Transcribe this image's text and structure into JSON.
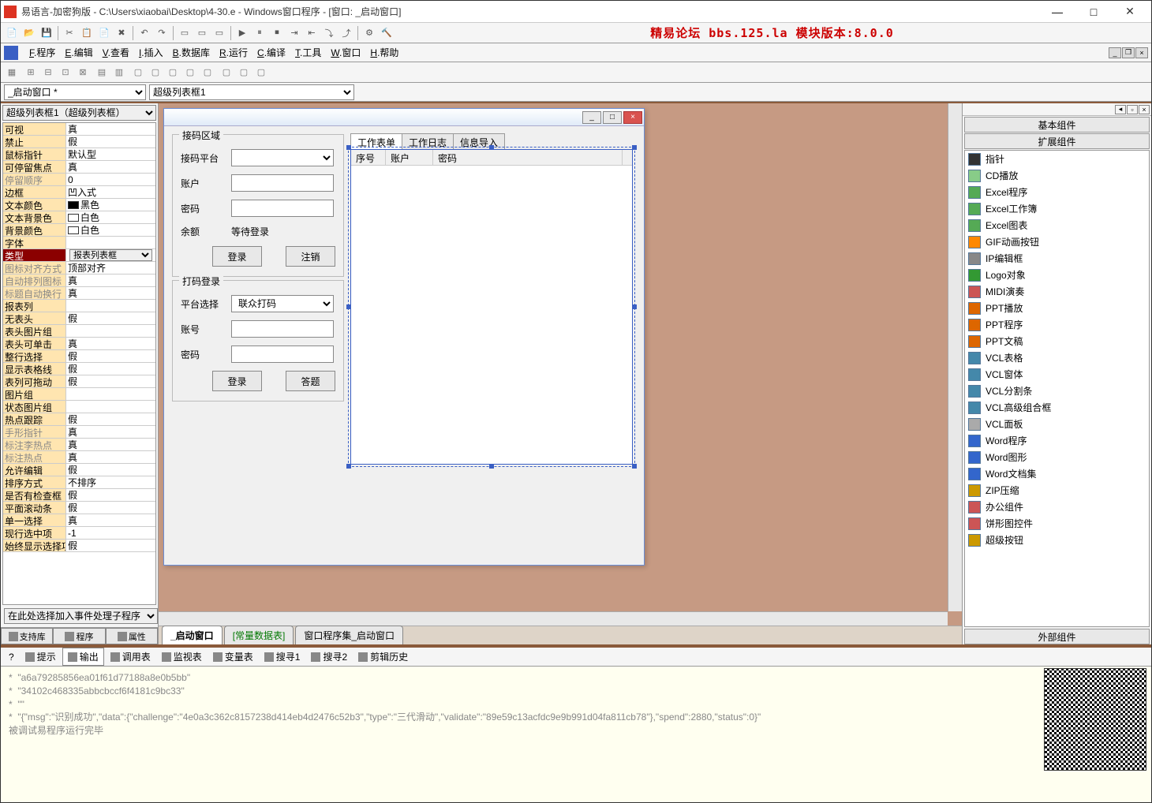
{
  "title": "易语言-加密狗版 - C:\\Users\\xiaobai\\Desktop\\4-30.e - Windows窗口程序 - [窗口: _启动窗口]",
  "banner": "精易论坛 bbs.125.la 模块版本:8.0.0",
  "menus": [
    "F.程序",
    "E.编辑",
    "V.查看",
    "I.插入",
    "B.数据库",
    "R.运行",
    "C.编译",
    "T.工具",
    "W.窗口",
    "H.帮助"
  ],
  "selectors": {
    "window": "_启动窗口 *",
    "control": "超级列表框1"
  },
  "leftCombo": "超级列表框1（超级列表框）",
  "propGrid": [
    {
      "n": "可视",
      "v": "真"
    },
    {
      "n": "禁止",
      "v": "假"
    },
    {
      "n": "鼠标指针",
      "v": "默认型"
    },
    {
      "n": "可停留焦点",
      "v": "真"
    },
    {
      "n": "停留顺序",
      "v": "0",
      "dim": true,
      "indent": true
    },
    {
      "n": "边框",
      "v": "凹入式"
    },
    {
      "n": "文本颜色",
      "v": "黑色",
      "swatch": "#000000"
    },
    {
      "n": "文本背景色",
      "v": "白色",
      "swatch": "#ffffff"
    },
    {
      "n": "背景颜色",
      "v": "白色",
      "swatch": "#ffffff"
    },
    {
      "n": "字体",
      "v": ""
    },
    {
      "n": "类型",
      "v": "报表列表框",
      "sel": true,
      "dd": true
    },
    {
      "n": "图标对齐方式",
      "v": "顶部对齐",
      "dim": true,
      "indent": true
    },
    {
      "n": "自动排列图标",
      "v": "真",
      "dim": true,
      "indent": true
    },
    {
      "n": "标题自动换行",
      "v": "真",
      "dim": true,
      "indent": true
    },
    {
      "n": "报表列",
      "v": "",
      "indent": true
    },
    {
      "n": "无表头",
      "v": "假",
      "indent": true
    },
    {
      "n": "表头图片组",
      "v": "",
      "indent": true
    },
    {
      "n": "表头可单击",
      "v": "真",
      "indent": true
    },
    {
      "n": "整行选择",
      "v": "假",
      "indent": true
    },
    {
      "n": "显示表格线",
      "v": "假",
      "indent": true
    },
    {
      "n": "表列可拖动",
      "v": "假",
      "indent": true
    },
    {
      "n": "图片组",
      "v": ""
    },
    {
      "n": "状态图片组",
      "v": ""
    },
    {
      "n": "热点跟踪",
      "v": "假"
    },
    {
      "n": "手形指针",
      "v": "真",
      "dim": true,
      "indent": true
    },
    {
      "n": "标注李热点",
      "v": "真",
      "dim": true,
      "indent": true
    },
    {
      "n": "标注热点",
      "v": "真",
      "dim": true,
      "indent": true
    },
    {
      "n": "允许编辑",
      "v": "假"
    },
    {
      "n": "排序方式",
      "v": "不排序"
    },
    {
      "n": "是否有检查框",
      "v": "假"
    },
    {
      "n": "平面滚动条",
      "v": "假"
    },
    {
      "n": "单一选择",
      "v": "真"
    },
    {
      "n": "现行选中项",
      "v": "-1"
    },
    {
      "n": "始终显示选择项",
      "v": "假"
    }
  ],
  "eventCombo": "在此处选择加入事件处理子程序",
  "leftTabs": [
    "支持库",
    "程序",
    "属性"
  ],
  "form": {
    "group1": {
      "title": "接码区域",
      "platform_label": "接码平台",
      "account_label": "账户",
      "password_label": "密码",
      "balance_label": "余额",
      "wait_label": "等待登录",
      "login_btn": "登录",
      "logout_btn": "注销"
    },
    "group2": {
      "title": "打码登录",
      "platform_label": "平台选择",
      "platform_value": "联众打码",
      "account_label": "账号",
      "password_label": "密码",
      "login_btn": "登录",
      "answer_btn": "答题"
    },
    "tabs": [
      "工作表单",
      "工作日志",
      "信息导入"
    ],
    "lv_cols": [
      "序号",
      "账户",
      "密码"
    ]
  },
  "centerTabs": [
    {
      "label": "_启动窗口",
      "active": true
    },
    {
      "label": "[常量数据表]",
      "green": true
    },
    {
      "label": "窗口程序集_启动窗口"
    }
  ],
  "rightPanel": {
    "tabs": [
      "基本组件",
      "扩展组件"
    ],
    "footer": "外部组件",
    "items": [
      "指针",
      "CD播放",
      "Excel程序",
      "Excel工作簿",
      "Excel图表",
      "GIF动画按钮",
      "IP编辑框",
      "Logo对象",
      "MIDI演奏",
      "PPT播放",
      "PPT程序",
      "PPT文稿",
      "VCL表格",
      "VCL窗体",
      "VCL分割条",
      "VCL高级组合框",
      "VCL面板",
      "Word程序",
      "Word图形",
      "Word文档集",
      "ZIP压缩",
      "办公组件",
      "饼形图控件",
      "超级按钮"
    ]
  },
  "bottomTabs": [
    "提示",
    "输出",
    "调用表",
    "监视表",
    "变量表",
    "搜寻1",
    "搜寻2",
    "剪辑历史"
  ],
  "output_lines": [
    "*  \"a6a79285856ea01f61d77188a8e0b5bb\"",
    "*  \"34102c468335abbcbccf6f4181c9bc33\"",
    "*  \"\"",
    "*  \"{\"msg\":\"识别成功\",\"data\":{\"challenge\":\"4e0a3c362c8157238d414eb4d2476c52b3\",\"type\":\"三代滑动\",\"validate\":\"89e59c13acfdc9e9b991d04fa811cb78\"},\"spend\":2880,\"status\":0}\"",
    "被调试易程序运行完毕"
  ]
}
